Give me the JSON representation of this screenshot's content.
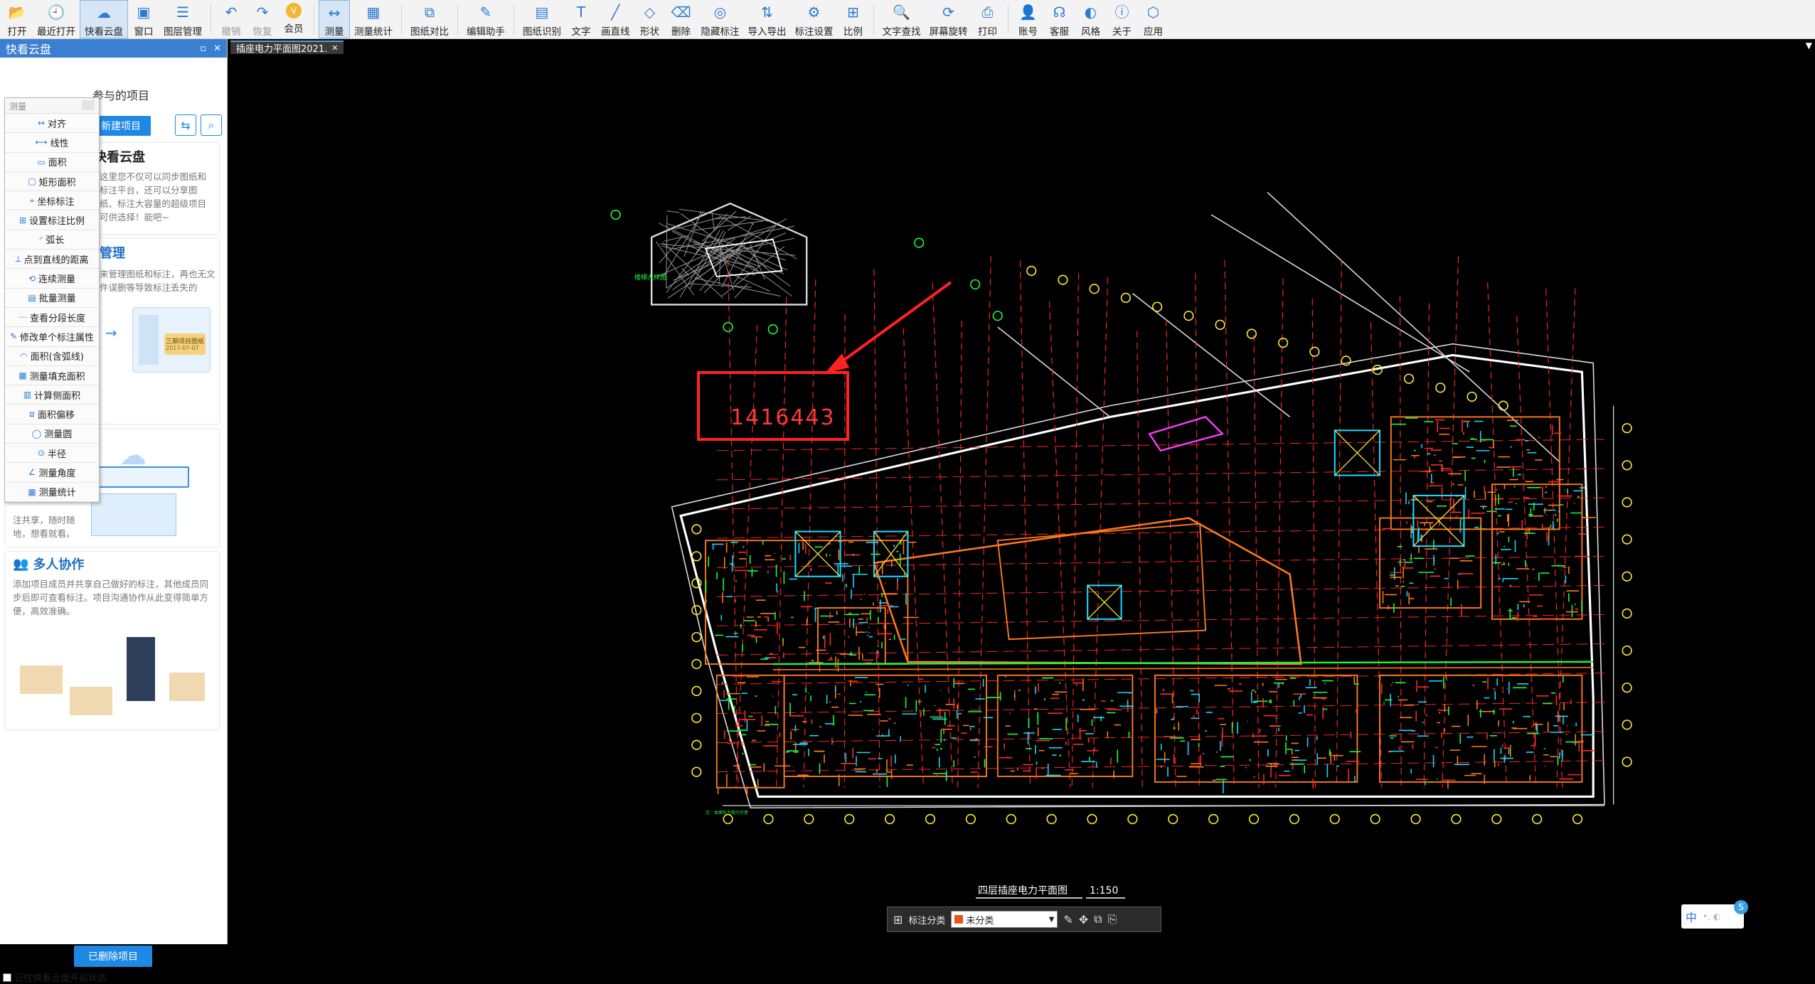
{
  "toolbar": {
    "items": [
      {
        "label": "打开",
        "icon": "folder-open-icon",
        "glyph": "📂"
      },
      {
        "label": "最近打开",
        "icon": "recent-icon",
        "glyph": "🕘"
      },
      {
        "label": "快看云盘",
        "icon": "cloud-icon",
        "glyph": "☁",
        "active": true
      },
      {
        "label": "窗口",
        "icon": "window-icon",
        "glyph": "▣"
      },
      {
        "label": "图层管理",
        "icon": "layers-icon",
        "glyph": "☰"
      },
      {
        "label": "撤销",
        "icon": "undo-icon",
        "glyph": "↶"
      },
      {
        "label": "恢复",
        "icon": "redo-icon",
        "glyph": "↷"
      },
      {
        "label": "会员",
        "icon": "vip-icon",
        "glyph": "V"
      },
      {
        "label": "测量",
        "icon": "measure-icon",
        "glyph": "↔",
        "active": true
      },
      {
        "label": "测量统计",
        "icon": "measure-stats-icon",
        "glyph": "▦"
      },
      {
        "label": "图纸对比",
        "icon": "compare-icon",
        "glyph": "⧉"
      },
      {
        "label": "编辑助手",
        "icon": "edit-assistant-icon",
        "glyph": "✎"
      },
      {
        "label": "图纸识别",
        "icon": "recognize-icon",
        "glyph": "▤"
      },
      {
        "label": "文字",
        "icon": "text-icon",
        "glyph": "T"
      },
      {
        "label": "画直线",
        "icon": "line-icon",
        "glyph": "╱"
      },
      {
        "label": "形状",
        "icon": "shape-icon",
        "glyph": "◇"
      },
      {
        "label": "删除",
        "icon": "eraser-icon",
        "glyph": "⌫"
      },
      {
        "label": "隐藏标注",
        "icon": "hide-icon",
        "glyph": "◎"
      },
      {
        "label": "导入导出",
        "icon": "import-export-icon",
        "glyph": "⇅"
      },
      {
        "label": "标注设置",
        "icon": "annotation-settings-icon",
        "glyph": "⚙"
      },
      {
        "label": "比例",
        "icon": "scale-icon",
        "glyph": "⊞"
      },
      {
        "label": "文字查找",
        "icon": "find-text-icon",
        "glyph": "🔍"
      },
      {
        "label": "屏幕旋转",
        "icon": "rotate-icon",
        "glyph": "⟳"
      },
      {
        "label": "打印",
        "icon": "print-icon",
        "glyph": "⎙"
      },
      {
        "label": "账号",
        "icon": "account-icon",
        "glyph": "👤"
      },
      {
        "label": "客服",
        "icon": "headset-icon",
        "glyph": "☊"
      },
      {
        "label": "风格",
        "icon": "style-icon",
        "glyph": "◐"
      },
      {
        "label": "关于",
        "icon": "info-icon",
        "glyph": "ⓘ"
      },
      {
        "label": "应用",
        "icon": "apps-icon",
        "glyph": "⬡"
      }
    ]
  },
  "left_panel": {
    "header": "快看云盘",
    "section_title": "参与的项目",
    "new_project": "新建项目",
    "card1_title": "快看云盘",
    "card1_text": "这里您不仅可以同步图纸和标注平台，还可以分享图纸、标注大容量的超级项目可供选择！能吧~",
    "card2_title": "管理",
    "card2_text": "来管理图纸和标注，再也无文件误删等导致标注丢失的",
    "card2_file_name": "三期项目图纸",
    "card2_file_date": "2017-07-07",
    "card3_text": "注共享，随时随地，想看就看。",
    "card4_title": "多人协作",
    "card4_text": "添加项目成员并共享自己做好的标注，其他成员同步后即可查看标注。项目沟通协作从此变得简单方便，高效准确。",
    "deleted_button": "已删除项目",
    "remember_label": "记住快看云盘开启状态"
  },
  "measure_menu": {
    "header": "测量",
    "items": [
      {
        "label": "对齐",
        "icon": "align-measure-icon",
        "glyph": "↔"
      },
      {
        "label": "线性",
        "icon": "linear-measure-icon",
        "glyph": "⟷"
      },
      {
        "label": "面积",
        "icon": "area-icon",
        "glyph": "▭"
      },
      {
        "label": "矩形面积",
        "icon": "rect-area-icon",
        "glyph": "▢"
      },
      {
        "label": "坐标标注",
        "icon": "coordinate-icon",
        "glyph": "⌖"
      },
      {
        "label": "设置标注比例",
        "icon": "set-scale-icon",
        "glyph": "⊞"
      },
      {
        "label": "弧长",
        "icon": "arc-length-icon",
        "glyph": "◜"
      },
      {
        "label": "点到直线的距离",
        "icon": "point-line-distance-icon",
        "glyph": "⟂"
      },
      {
        "label": "连续测量",
        "icon": "continuous-measure-icon",
        "glyph": "⟲"
      },
      {
        "label": "批量测量",
        "icon": "batch-measure-icon",
        "glyph": "▤"
      },
      {
        "label": "查看分段长度",
        "icon": "segment-length-icon",
        "glyph": "⋯"
      },
      {
        "label": "修改单个标注属性",
        "icon": "modify-annotation-icon",
        "glyph": "✎"
      },
      {
        "label": "面积(含弧线)",
        "icon": "arc-area-icon",
        "glyph": "◠"
      },
      {
        "label": "测量填充面积",
        "icon": "fill-area-icon",
        "glyph": "▩"
      },
      {
        "label": "计算侧面积",
        "icon": "side-area-icon",
        "glyph": "▥"
      },
      {
        "label": "面积偏移",
        "icon": "area-offset-icon",
        "glyph": "⧈"
      },
      {
        "label": "测量圆",
        "icon": "measure-circle-icon",
        "glyph": "◯"
      },
      {
        "label": "半径",
        "icon": "radius-icon",
        "glyph": "⊙"
      },
      {
        "label": "测量角度",
        "icon": "angle-icon",
        "glyph": "∠"
      },
      {
        "label": "测量统计",
        "icon": "stats-icon",
        "glyph": "▦"
      }
    ]
  },
  "document": {
    "tab_title": "插座电力平面图2021.",
    "measurement_value": "1416443",
    "detail_caption": "楼梯大样图",
    "drawing_title": "四层插座电力平面图",
    "drawing_scale": "1:150",
    "tiny_note": "注：本图仅为电力示意"
  },
  "bottom_bar": {
    "category_label": "标注分类",
    "category_value": "未分类",
    "category_color": "#e2561a"
  },
  "ime": {
    "label": "中"
  },
  "colors": {
    "accent": "#1e88e5",
    "cad_red": "#ff2a2a",
    "cad_orange": "#ff7a1a",
    "cad_green": "#19ff3c",
    "cad_cyan": "#19d7ff",
    "cad_magenta": "#ff3cff",
    "cad_yellow": "#ffee33"
  }
}
